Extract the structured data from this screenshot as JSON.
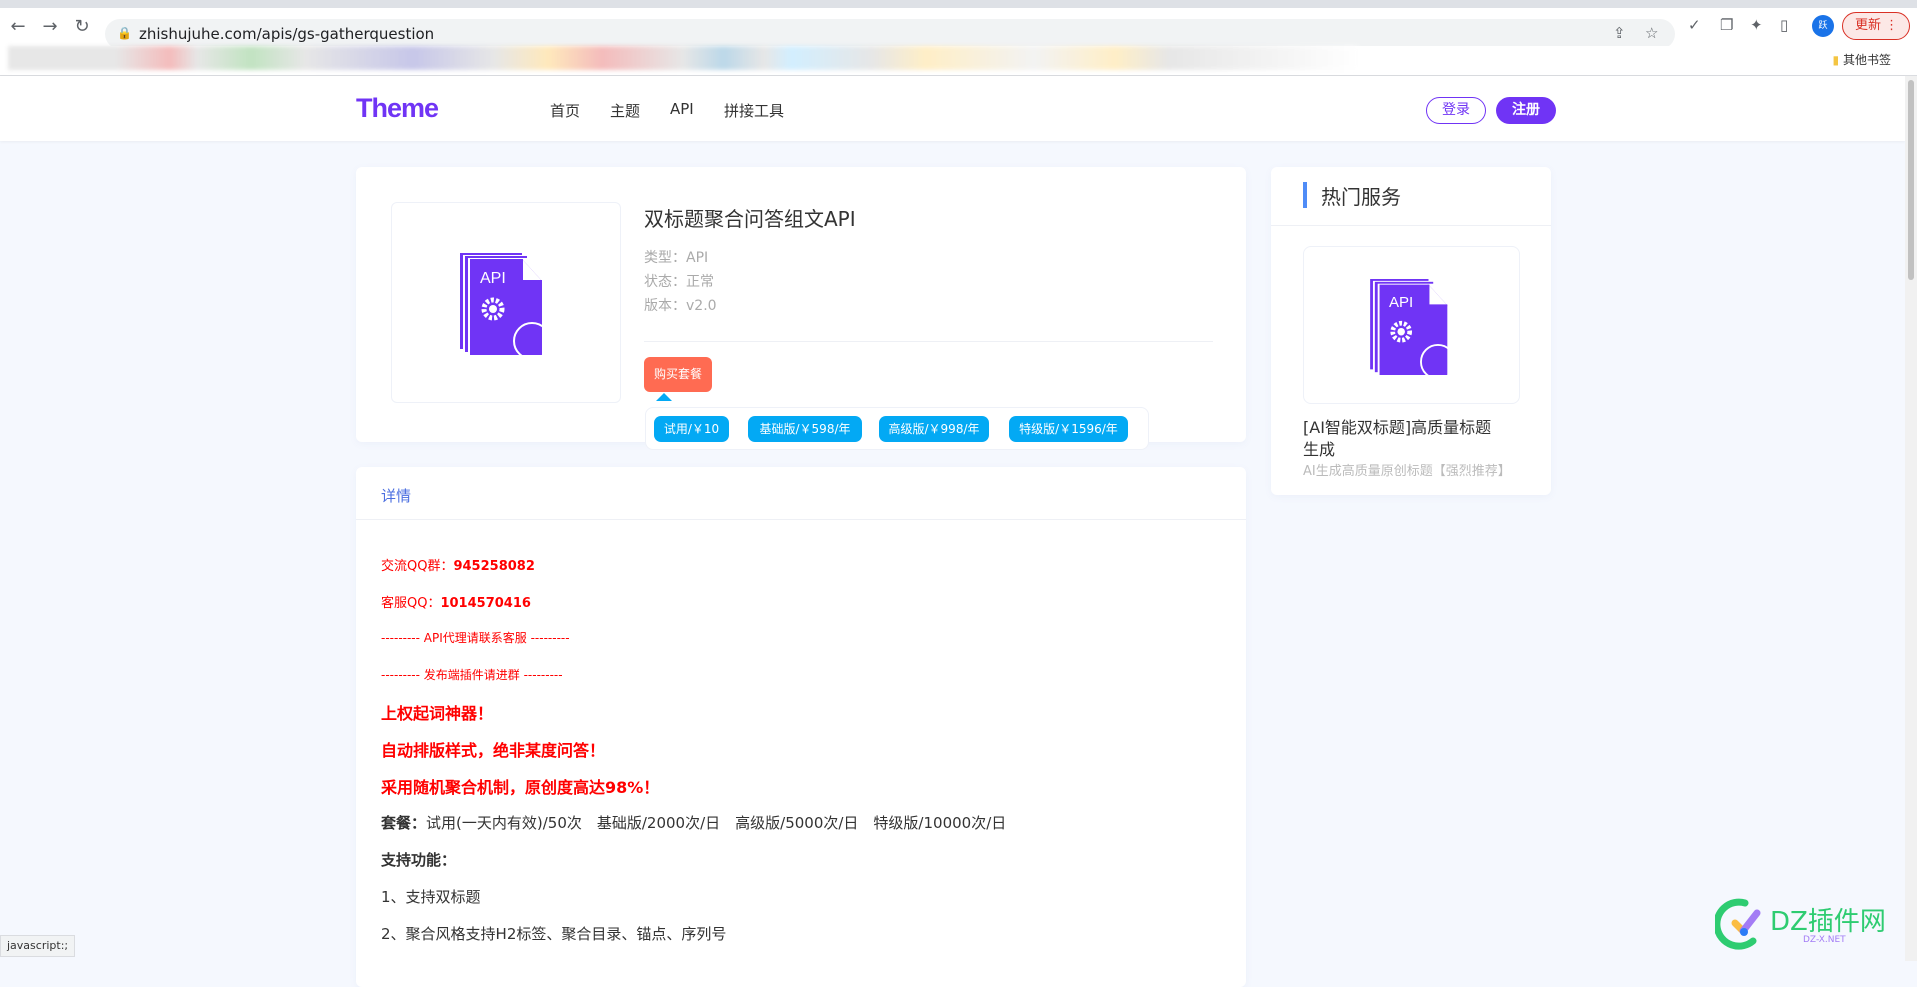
{
  "browser": {
    "url": "zhishujuhe.com/apis/gs-gatherquestion",
    "update_label": "更新",
    "profile_initial": "跃",
    "other_bookmarks": "其他书签",
    "status_text": "javascript:;"
  },
  "header": {
    "logo": "Theme",
    "nav": [
      "首页",
      "主题",
      "API",
      "拼接工具"
    ],
    "login": "登录",
    "register": "注册",
    "brand_color": "#7034f5"
  },
  "product": {
    "title": "双标题聚合问答组文API",
    "type": "类型：API",
    "status": "状态：正常",
    "version": "版本：v2.0",
    "buy_label": "购买套餐",
    "icon": "api-document-gear-icon",
    "plans": [
      "试用/￥10",
      "基础版/￥598/年",
      "高级版/￥998/年",
      "特级版/￥1596/年"
    ]
  },
  "detail": {
    "tab": "详情",
    "qq_group_label": "交流QQ群：",
    "qq_group": "945258082",
    "service_label": "客服QQ：",
    "service_qq": "1014570416",
    "agent_line": "--------- API代理请联系客服 ---------",
    "plugin_line": "--------- 发布端插件请进群 ---------",
    "slogan1": "上权起词神器！",
    "slogan2": "自动排版样式，绝非某度问答！",
    "slogan3": "采用随机聚合机制，原创度高达98%！",
    "plan_label": "套餐：",
    "plan_text": "试用(一天内有效)/50次　基础版/2000次/日　高级版/5000次/日　特级版/10000次/日",
    "features_label": "支持功能：",
    "features": [
      "1、支持双标题",
      "2、聚合风格支持H2标签、聚合目录、锚点、序列号"
    ]
  },
  "hot": {
    "title": "热门服务",
    "items": [
      {
        "name": "[AI智能双标题]高质量标题生成",
        "desc": "AI生成高质量原创标题【强烈推荐】"
      }
    ]
  },
  "watermark": {
    "text": "DZ插件网",
    "sub": "DZ-X.NET"
  }
}
